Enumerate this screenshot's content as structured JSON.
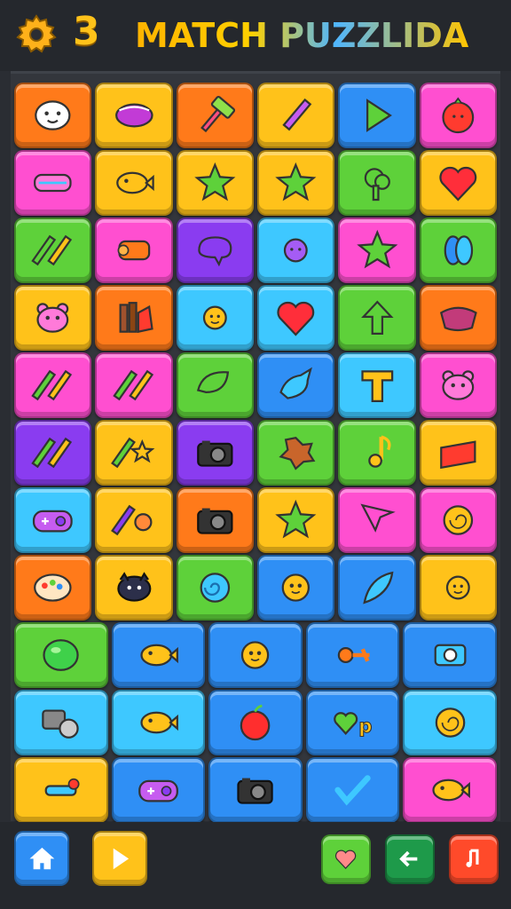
{
  "header": {
    "level": "3",
    "title": "MATCH PUZZLIDA",
    "settings_icon": "gear-icon"
  },
  "colors": {
    "orange": "#ff7a1a",
    "yellow": "#ffc21a",
    "pink": "#ff4fd0",
    "purple": "#8a3cf0",
    "green": "#5ed13a",
    "blue": "#2f8ff5",
    "cyan": "#3ec8ff",
    "red": "#ff3b2f"
  },
  "board": {
    "rows": [
      [
        {
          "color": "orange",
          "icon": "smiling-face-icon"
        },
        {
          "color": "yellow",
          "icon": "bowl-icon"
        },
        {
          "color": "orange",
          "icon": "hammer-icon"
        },
        {
          "color": "yellow",
          "icon": "pencil-icon"
        },
        {
          "color": "blue",
          "icon": "play-arrow-icon"
        },
        {
          "color": "pink",
          "icon": "tomato-icon"
        }
      ],
      [
        {
          "color": "pink",
          "icon": "candy-wrapper-icon"
        },
        {
          "color": "yellow",
          "icon": "fish-icon"
        },
        {
          "color": "yellow",
          "icon": "star-icon"
        },
        {
          "color": "yellow",
          "icon": "star-icon"
        },
        {
          "color": "green",
          "icon": "tree-icon"
        },
        {
          "color": "yellow",
          "icon": "heart-icon"
        }
      ],
      [
        {
          "color": "green",
          "icon": "crayons-icon"
        },
        {
          "color": "pink",
          "icon": "scroll-icon"
        },
        {
          "color": "purple",
          "icon": "blob-icon"
        },
        {
          "color": "cyan",
          "icon": "virus-icon"
        },
        {
          "color": "pink",
          "icon": "star-icon"
        },
        {
          "color": "green",
          "icon": "spool-icon"
        }
      ],
      [
        {
          "color": "yellow",
          "icon": "bear-face-icon"
        },
        {
          "color": "orange",
          "icon": "logs-icon"
        },
        {
          "color": "cyan",
          "icon": "sun-icon"
        },
        {
          "color": "cyan",
          "icon": "heart-icon"
        },
        {
          "color": "green",
          "icon": "arrow-up-icon"
        },
        {
          "color": "orange",
          "icon": "meat-icon"
        }
      ],
      [
        {
          "color": "pink",
          "icon": "crayons-icon"
        },
        {
          "color": "pink",
          "icon": "crayons-icon"
        },
        {
          "color": "green",
          "icon": "leaf-icon"
        },
        {
          "color": "blue",
          "icon": "bird-icon"
        },
        {
          "color": "cyan",
          "icon": "letter-t-icon"
        },
        {
          "color": "pink",
          "icon": "bear-face-icon"
        }
      ],
      [
        {
          "color": "purple",
          "icon": "crayons-icon"
        },
        {
          "color": "yellow",
          "icon": "crayon-star-icon"
        },
        {
          "color": "purple",
          "icon": "camera-icon"
        },
        {
          "color": "green",
          "icon": "cookie-icon"
        },
        {
          "color": "green",
          "icon": "music-note-icon"
        },
        {
          "color": "yellow",
          "icon": "cheese-icon"
        }
      ],
      [
        {
          "color": "cyan",
          "icon": "gamepad-icon"
        },
        {
          "color": "yellow",
          "icon": "crayon-cookie-icon"
        },
        {
          "color": "orange",
          "icon": "camera-icon"
        },
        {
          "color": "yellow",
          "icon": "star-icon"
        },
        {
          "color": "pink",
          "icon": "cursor-arrow-icon"
        },
        {
          "color": "pink",
          "icon": "shell-icon"
        }
      ],
      [
        {
          "color": "orange",
          "icon": "palette-icon"
        },
        {
          "color": "yellow",
          "icon": "cat-face-icon"
        },
        {
          "color": "green",
          "icon": "spiral-icon"
        },
        {
          "color": "blue",
          "icon": "face-icon"
        },
        {
          "color": "blue",
          "icon": "feather-icon"
        },
        {
          "color": "yellow",
          "icon": "sun-icon"
        }
      ],
      [
        {
          "color": "green",
          "icon": "ball-icon"
        },
        {
          "color": "blue",
          "icon": "fish-icon"
        },
        {
          "color": "blue",
          "icon": "face-icon"
        },
        {
          "color": "blue",
          "icon": "wrench-icon"
        },
        {
          "color": "blue",
          "icon": "tape-icon"
        }
      ],
      [
        {
          "color": "cyan",
          "icon": "film-reel-icon"
        },
        {
          "color": "cyan",
          "icon": "fish-icon"
        },
        {
          "color": "blue",
          "icon": "apple-icon"
        },
        {
          "color": "blue",
          "icon": "heart-letter-icon"
        },
        {
          "color": "cyan",
          "icon": "shell-icon"
        }
      ],
      [
        {
          "color": "yellow",
          "icon": "bone-icon"
        },
        {
          "color": "blue",
          "icon": "gamepad-icon"
        },
        {
          "color": "blue",
          "icon": "camera-icon"
        },
        {
          "color": "blue",
          "icon": "checkmark-icon"
        },
        {
          "color": "pink",
          "icon": "fish-icon"
        }
      ]
    ]
  },
  "footer": {
    "buttons": [
      {
        "name": "home-button",
        "icon": "home-icon",
        "color": "#2f8ff5"
      },
      {
        "name": "play-button",
        "icon": "play-icon",
        "color": "#ffc21a"
      },
      {
        "name": "like-button",
        "icon": "heart-icon",
        "color": "#5ed13a"
      },
      {
        "name": "share-button",
        "icon": "arrow-left-icon",
        "color": "#1e9a4a"
      },
      {
        "name": "music-button",
        "icon": "music-note-icon",
        "color": "#ff4a2a"
      }
    ]
  }
}
